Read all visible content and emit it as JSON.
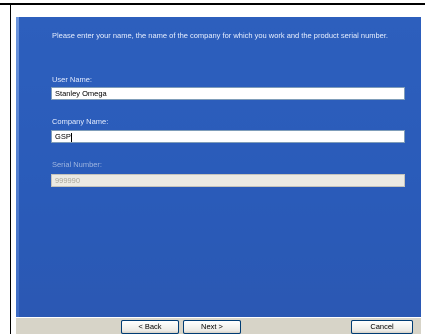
{
  "intro_text": "Please enter your name, the name of the company for which you work and the product serial number.",
  "fields": {
    "user_name": {
      "label": "User Name:",
      "value": "Stanley Omega"
    },
    "company_name": {
      "label": "Company Name:",
      "value": "GSP"
    },
    "serial_number": {
      "label": "Serial Number:",
      "value": "999990"
    }
  },
  "buttons": {
    "back": "< Back",
    "next": "Next >",
    "cancel": "Cancel"
  },
  "colors": {
    "panel": "#2a5bb8",
    "field_border": "#7f9db9",
    "button_border": "#003c74"
  }
}
